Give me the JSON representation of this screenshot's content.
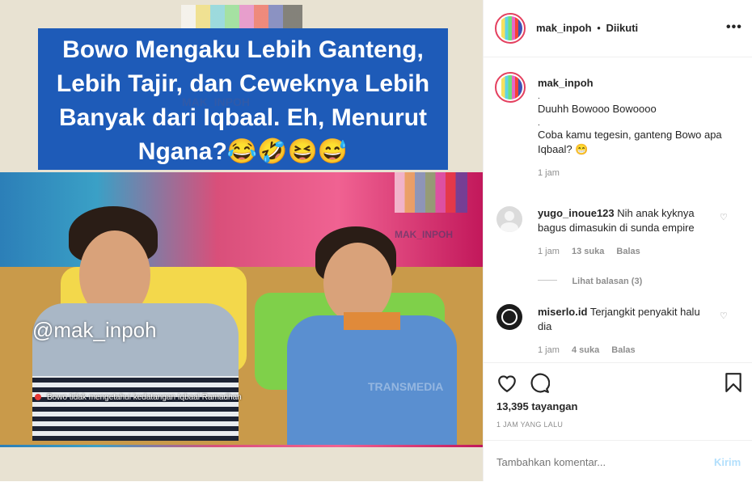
{
  "media": {
    "caption": "Bowo Mengaku Lebih Ganteng, Lebih Tajir, dan Ceweknya Lebih Banyak dari Iqbaal. Eh, Menurut Ngana?😂🤣😆😅",
    "watermark_1": "MAK_INPOH",
    "watermark_2": "MAK_INPOH",
    "handle_watermark": "@mak_inpoh",
    "ticker": "Bowo tidak mengetahui kedatangan Iqbaal Ramadhan",
    "channel": "TRANSMEDIA"
  },
  "header": {
    "username": "mak_inpoh",
    "separator": "•",
    "follow_status": "Diikuti",
    "more": "•••"
  },
  "post": {
    "username": "mak_inpoh",
    "caption_lines": [
      ". ",
      "Duuhh Bowooo Bowoooo",
      ".",
      "Coba kamu tegesin, ganteng Bowo apa Iqbaal? 😁"
    ],
    "time": "1 jam"
  },
  "comments": [
    {
      "username": "yugo_inoue123",
      "text": "Nih anak kyknya bagus dimasukin di sunda empire",
      "time": "1 jam",
      "likes": "13 suka",
      "reply": "Balas",
      "view_replies": "Lihat balasan (3)"
    },
    {
      "username": "miserlo.id",
      "text": "Terjangkit penyakit halu dia",
      "time": "1 jam",
      "likes": "4 suka",
      "reply": "Balas"
    }
  ],
  "actions": {
    "views": "13,395 tayangan",
    "posted": "1 JAM YANG LALU"
  },
  "add_comment": {
    "placeholder": "Tambahkan komentar...",
    "submit": "Kirim"
  },
  "colors": {
    "link_blue": "#b2dffc",
    "muted": "#8e8e8e",
    "caption_bg": "#1e5bb8"
  }
}
